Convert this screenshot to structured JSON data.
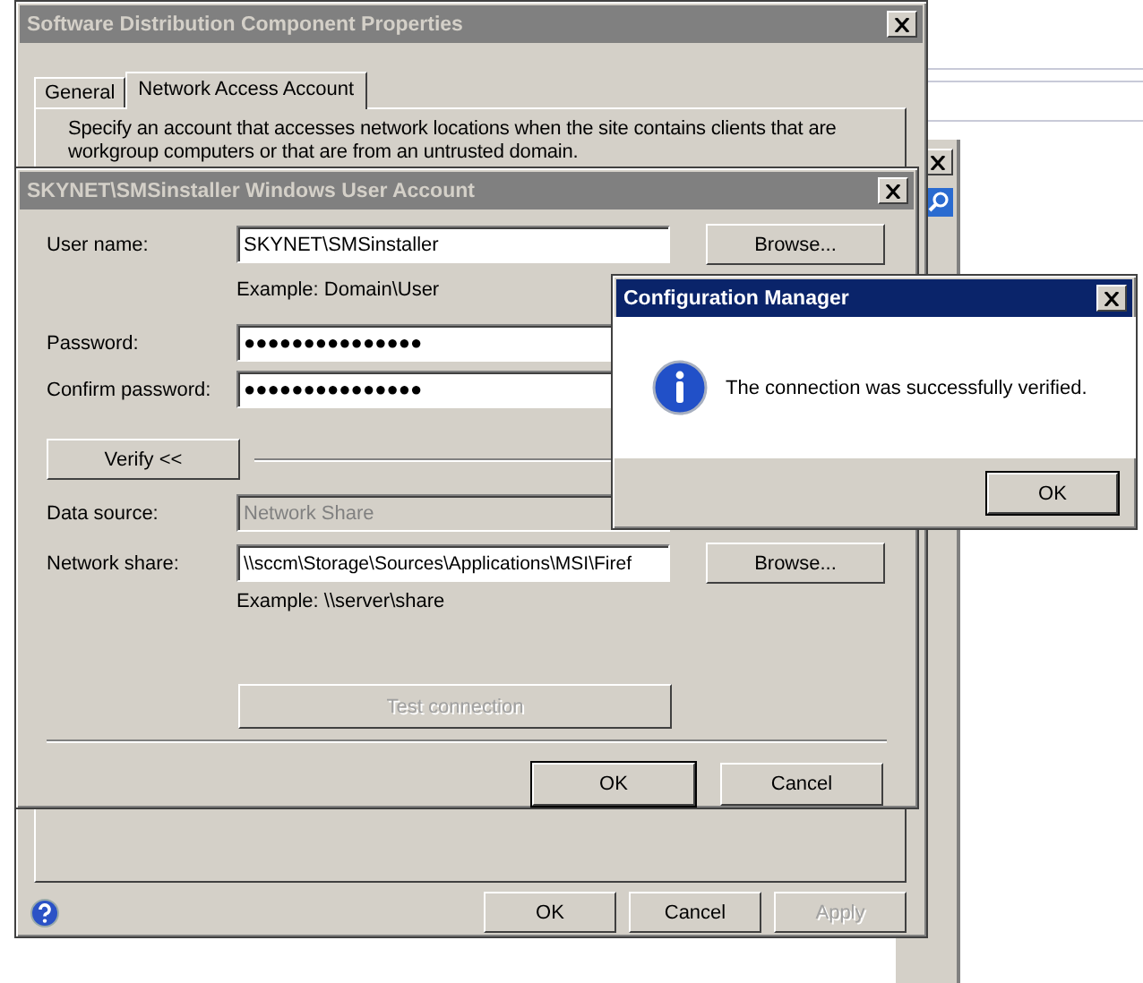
{
  "main_window": {
    "title": "Software Distribution Component Properties",
    "active": false,
    "tabs": [
      {
        "label": "General",
        "selected": false
      },
      {
        "label": "Network Access Account",
        "selected": true
      }
    ],
    "description": "Specify an account that accesses network locations when the site contains clients that are\nworkgroup computers or that are from an untrusted domain.",
    "buttons": [
      {
        "label": "OK",
        "disabled": false
      },
      {
        "label": "Cancel",
        "disabled": false
      },
      {
        "label": "Apply",
        "disabled": true
      }
    ]
  },
  "account_dialog": {
    "title": "SKYNET\\SMSinstaller Windows User Account",
    "active": false,
    "user_name": {
      "label": "User name:",
      "value": "SKYNET\\SMSinstaller",
      "hint": "Example: Domain\\User",
      "button": "Browse..."
    },
    "password": {
      "label": "Password:",
      "value": "●●●●●●●●●●●●●●●"
    },
    "confirm_password": {
      "label": "Confirm password:",
      "value": "●●●●●●●●●●●●●●●"
    },
    "verify_button": "Verify <<",
    "data_source": {
      "label": "Data source:",
      "value": "Network Share",
      "disabled": true
    },
    "network_share": {
      "label": "Network share:",
      "value": "\\\\sccm\\Storage\\Sources\\Applications\\MSI\\Firef",
      "hint": "Example: \\\\server\\share",
      "button": "Browse..."
    },
    "test_button": {
      "label": "Test connection",
      "disabled": true
    },
    "buttons": [
      {
        "label": "OK",
        "default": true
      },
      {
        "label": "Cancel",
        "default": false
      }
    ]
  },
  "message_box": {
    "title": "Configuration Manager",
    "active": true,
    "message": "The connection was successfully verified.",
    "button": "OK"
  }
}
